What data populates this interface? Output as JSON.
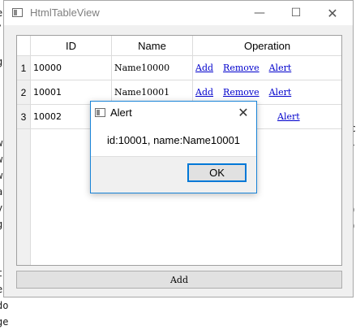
{
  "window": {
    "title": "HtmlTableView",
    "minimize_glyph": "—",
    "maximize_glyph": "☐",
    "close_glyph": "✕"
  },
  "table": {
    "headers": [
      "ID",
      "Name",
      "Operation"
    ],
    "rows": [
      {
        "num": "1",
        "id": "10000",
        "name": "Name10000",
        "actions": [
          "Add",
          "Remove",
          "Alert"
        ]
      },
      {
        "num": "2",
        "id": "10001",
        "name": "Name10001",
        "actions": [
          "Add",
          "Remove",
          "Alert"
        ]
      },
      {
        "num": "3",
        "id": "10002",
        "name": "",
        "actions": [
          "",
          "",
          "Alert"
        ]
      }
    ]
  },
  "add_button": "Add",
  "dialog": {
    "title": "Alert",
    "close_glyph": "✕",
    "message": "id:10001, name:Name10001",
    "ok_label": "OK"
  },
  "colors": {
    "link": "#0000cc",
    "dialog_border": "#1883d7",
    "ok_focus": "#0078d7"
  }
}
